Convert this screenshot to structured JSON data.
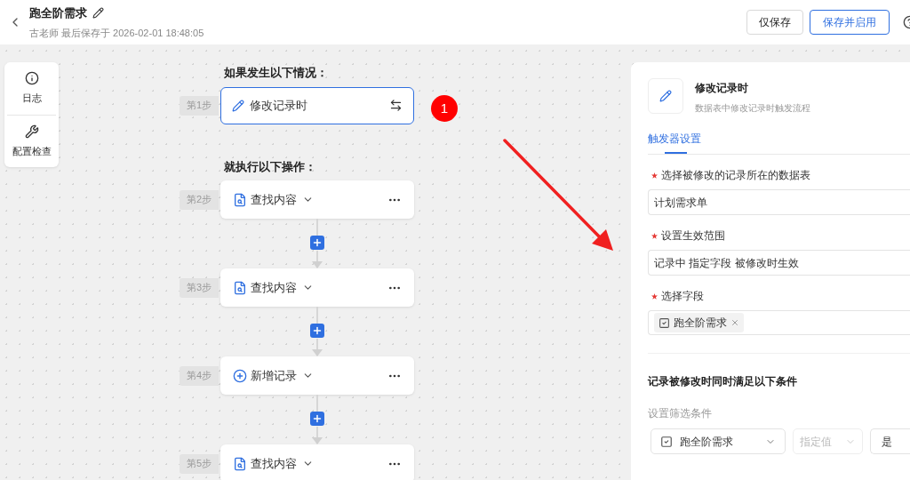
{
  "header": {
    "title": "跑全阶需求",
    "subtitle": "古老师 最后保存于 2026-02-01 18:48:05",
    "buttons": [
      {
        "label": "仅保存",
        "kind": "plain"
      },
      {
        "label": "保存并启用",
        "kind": "primary"
      }
    ]
  },
  "toolbar": [
    {
      "label": "日志",
      "kind": "info"
    },
    {
      "label": "配置检查",
      "kind": "wrench"
    }
  ],
  "flow": {
    "trigger_heading": "如果发生以下情况：",
    "trigger": {
      "step": "第1步",
      "label": "修改记录时",
      "selected": true
    },
    "actions_heading": "就执行以下操作：",
    "actions": [
      {
        "step": "第2步",
        "label": "查找内容",
        "kind": "find"
      },
      {
        "step": "第3步",
        "label": "查找内容",
        "kind": "find"
      },
      {
        "step": "第4步",
        "label": "新增记录",
        "kind": "add"
      },
      {
        "step": "第5步",
        "label": "查找内容",
        "kind": "find"
      }
    ]
  },
  "badge": "1",
  "panel": {
    "title": "修改记录时",
    "description": "数据表中修改记录时触发流程",
    "tabs": [
      {
        "label": "触发器设置",
        "selected": true
      }
    ],
    "fields": [
      {
        "label": "选择被修改的记录所在的数据表",
        "required": true,
        "kind": "text",
        "value": "计划需求单"
      },
      {
        "label": "设置生效范围",
        "required": true,
        "kind": "text",
        "value": "记录中 指定字段 被修改时生效"
      },
      {
        "label": "选择字段",
        "required": true,
        "kind": "tags",
        "tags": [
          "跑全阶需求"
        ]
      }
    ],
    "section_title": "记录被修改时同时满足以下条件",
    "filter_label": "设置筛选条件",
    "filter": {
      "field": "跑全阶需求",
      "operator": {
        "label": "指定值",
        "disabled": true
      },
      "value": "是"
    }
  }
}
